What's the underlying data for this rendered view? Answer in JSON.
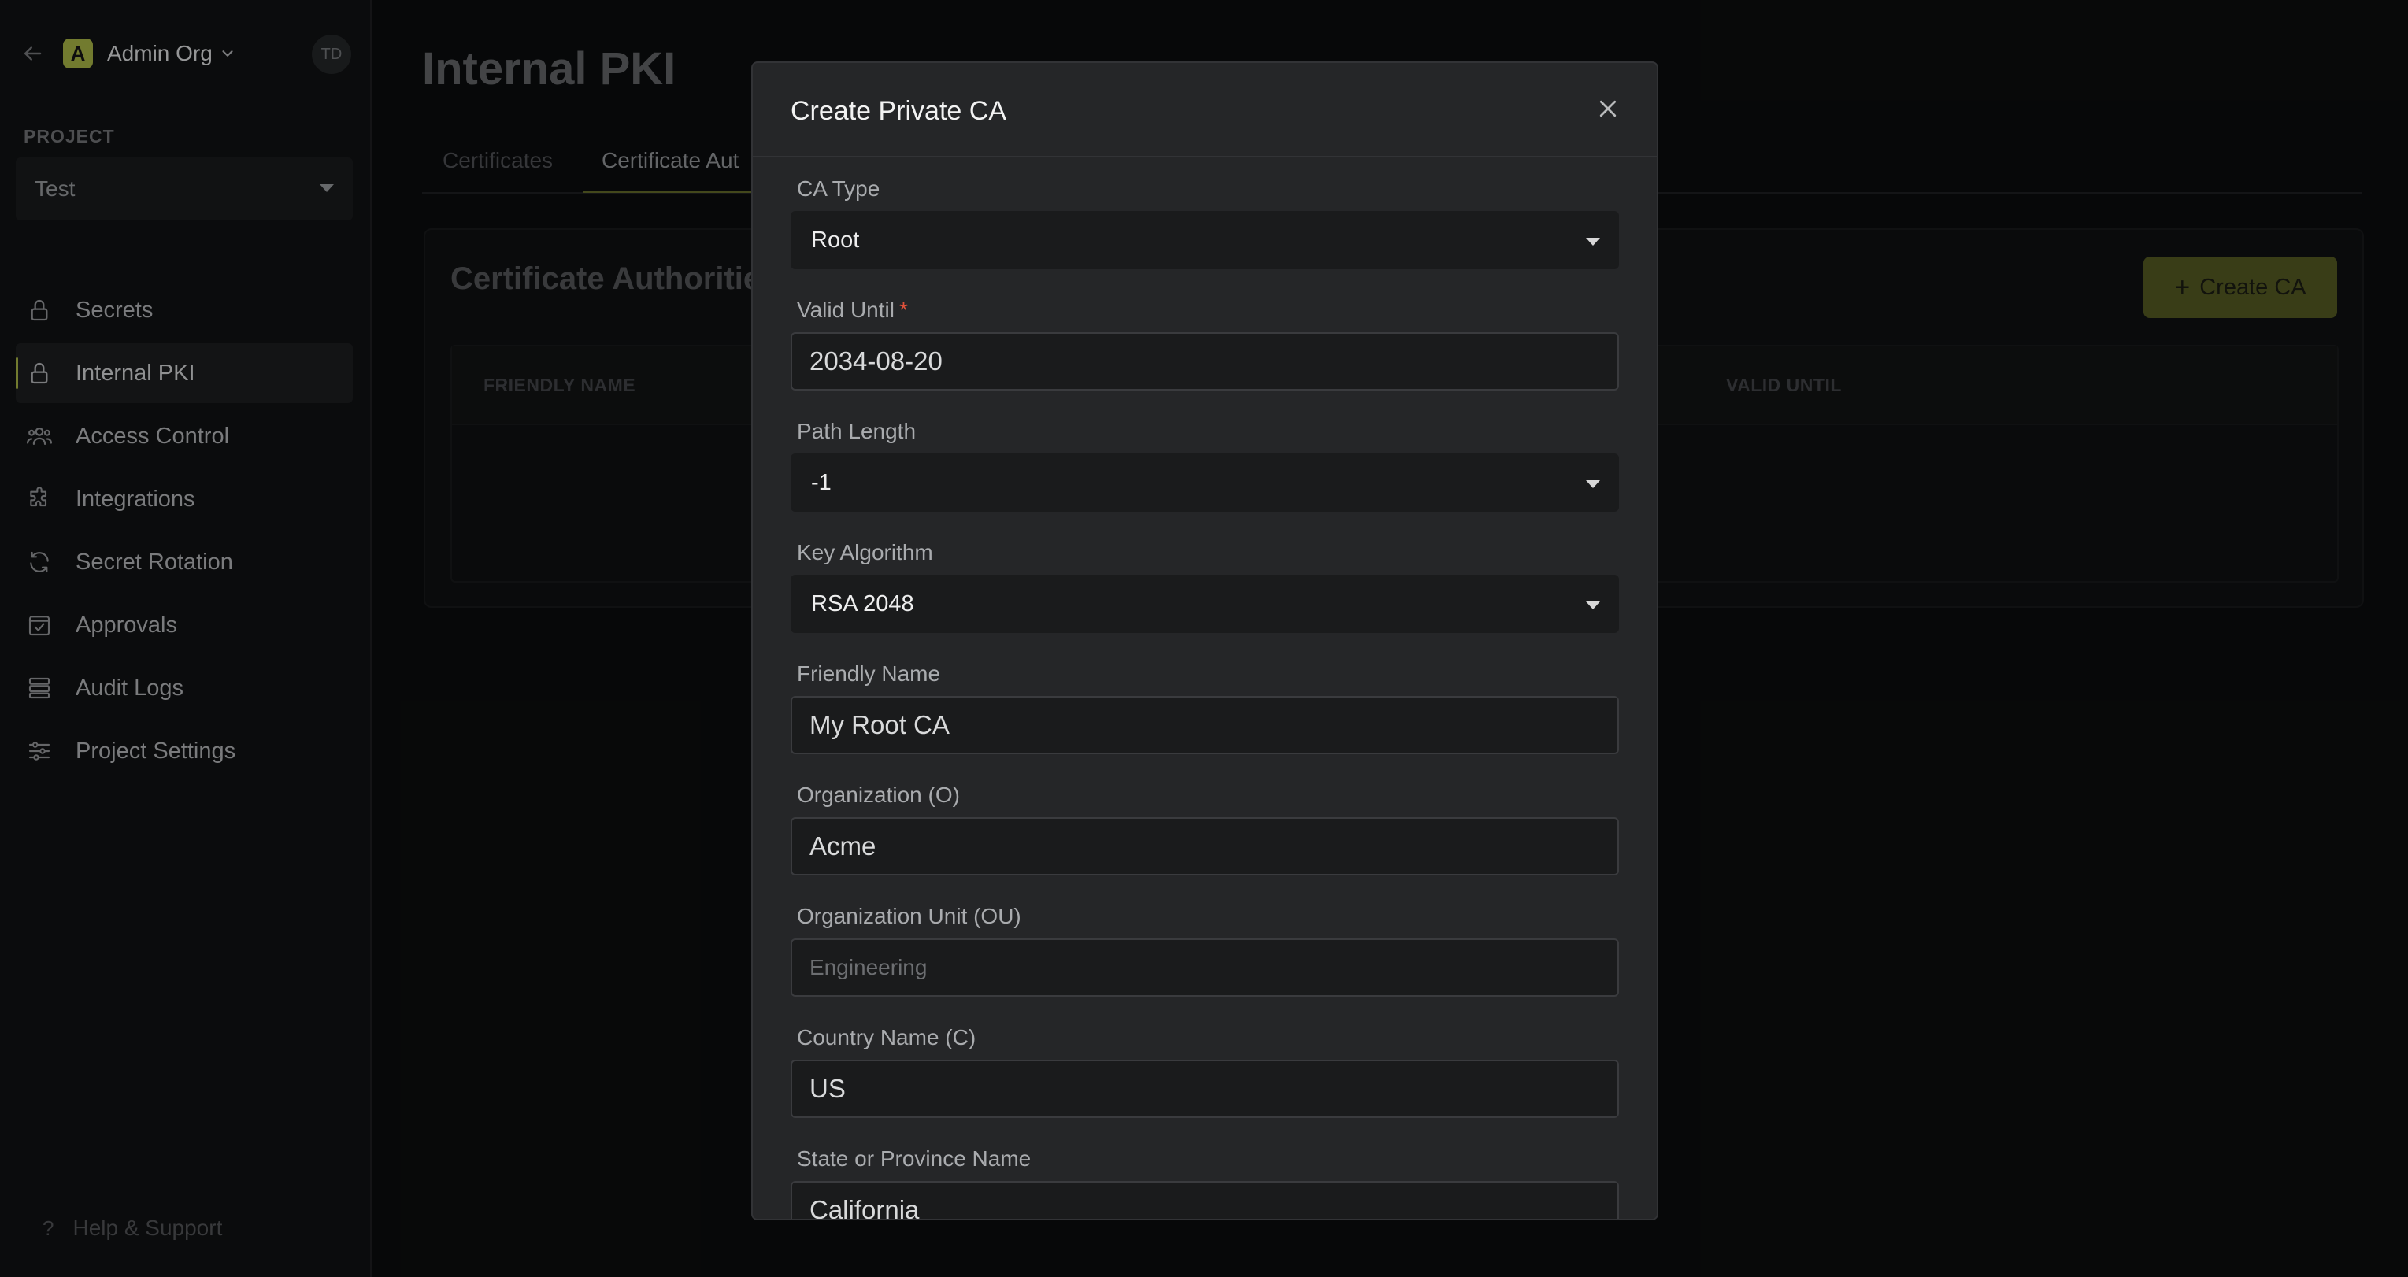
{
  "sidebar": {
    "org_name": "Admin Org",
    "org_initial": "A",
    "avatar_initials": "TD",
    "project_label": "PROJECT",
    "project_value": "Test",
    "items": [
      {
        "label": "Secrets",
        "icon": "lock-icon",
        "active": false
      },
      {
        "label": "Internal PKI",
        "icon": "lock-icon",
        "active": true
      },
      {
        "label": "Access Control",
        "icon": "users-icon",
        "active": false
      },
      {
        "label": "Integrations",
        "icon": "puzzle-icon",
        "active": false
      },
      {
        "label": "Secret Rotation",
        "icon": "rotate-icon",
        "active": false
      },
      {
        "label": "Approvals",
        "icon": "checkbox-icon",
        "active": false
      },
      {
        "label": "Audit Logs",
        "icon": "logs-icon",
        "active": false
      },
      {
        "label": "Project Settings",
        "icon": "sliders-icon",
        "active": false
      }
    ],
    "help_label": "Help & Support"
  },
  "main": {
    "title": "Internal PKI",
    "tabs": [
      {
        "label": "Certificates"
      },
      {
        "label": "Certificate Aut"
      }
    ],
    "panel_title": "Certificate Authoritie",
    "create_button": "Create CA",
    "columns": [
      "FRIENDLY NAME",
      "VALID UNTIL"
    ]
  },
  "modal": {
    "title": "Create Private CA",
    "fields": {
      "ca_type": {
        "label": "CA Type",
        "value": "Root"
      },
      "valid_until": {
        "label": "Valid Until",
        "required_mark": "*",
        "value": "2034-08-20"
      },
      "path_length": {
        "label": "Path Length",
        "value": "-1"
      },
      "key_algorithm": {
        "label": "Key Algorithm",
        "value": "RSA 2048"
      },
      "friendly_name": {
        "label": "Friendly Name",
        "value": "My Root CA"
      },
      "organization": {
        "label": "Organization (O)",
        "value": "Acme"
      },
      "org_unit": {
        "label": "Organization Unit (OU)",
        "value": "",
        "placeholder": "Engineering"
      },
      "country": {
        "label": "Country Name (C)",
        "value": "US"
      },
      "state": {
        "label": "State or Province Name",
        "value": "California"
      }
    }
  },
  "colors": {
    "accent": "#9eab42",
    "required": "#e0513b"
  }
}
